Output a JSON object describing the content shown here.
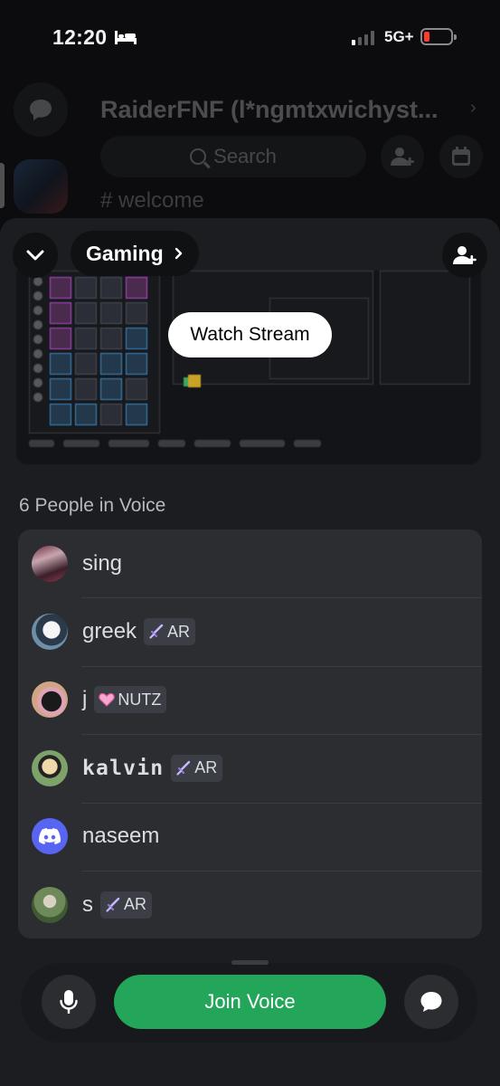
{
  "status_bar": {
    "time": "12:20",
    "network": "5G+",
    "signal_bars_active": 1,
    "signal_bars_total": 4,
    "battery_level": 0.12,
    "battery_color": "#ff3b30",
    "icons": [
      "bed-icon",
      "signal-icon",
      "battery-icon"
    ]
  },
  "background": {
    "server_title": "RaiderFNF (l*ngmtxwichyst...",
    "search_placeholder": "Search",
    "channel": "# welcome",
    "icons": [
      "dm-icon",
      "server-icon",
      "add-member-icon",
      "calendar-icon",
      "chevron-right-icon"
    ]
  },
  "sheet": {
    "channel_name": "Gaming",
    "watch_stream_label": "Watch Stream",
    "voice_header": "6 People in Voice",
    "icons": [
      "chevron-down-icon",
      "chevron-right-icon",
      "invite-member-icon"
    ],
    "members": [
      {
        "name": "sing",
        "tag": null,
        "avatar": "photo"
      },
      {
        "name": "greek",
        "tag": {
          "icon": "sword-icon",
          "label": "AR"
        },
        "avatar": "photo"
      },
      {
        "name": "j",
        "tag": {
          "icon": "heart-icon",
          "label": "NUTZ"
        },
        "avatar": "photo"
      },
      {
        "name": "kalvin",
        "tag": {
          "icon": "sword-icon",
          "label": "AR"
        },
        "avatar": "photo"
      },
      {
        "name": "naseem",
        "tag": null,
        "avatar": "discord-logo"
      },
      {
        "name": "s",
        "tag": {
          "icon": "sword-icon",
          "label": "AR"
        },
        "avatar": "photo"
      }
    ]
  },
  "bottom_bar": {
    "join_voice_label": "Join Voice",
    "icons": [
      "microphone-icon",
      "chat-bubble-icon"
    ]
  },
  "colors": {
    "sheet_bg": "#1c1d21",
    "list_bg": "#2b2d31",
    "join_green": "#23a55a",
    "discord_blurple": "#5865f2",
    "text_primary": "#f2f3f5",
    "text_muted": "#b5bac1"
  }
}
